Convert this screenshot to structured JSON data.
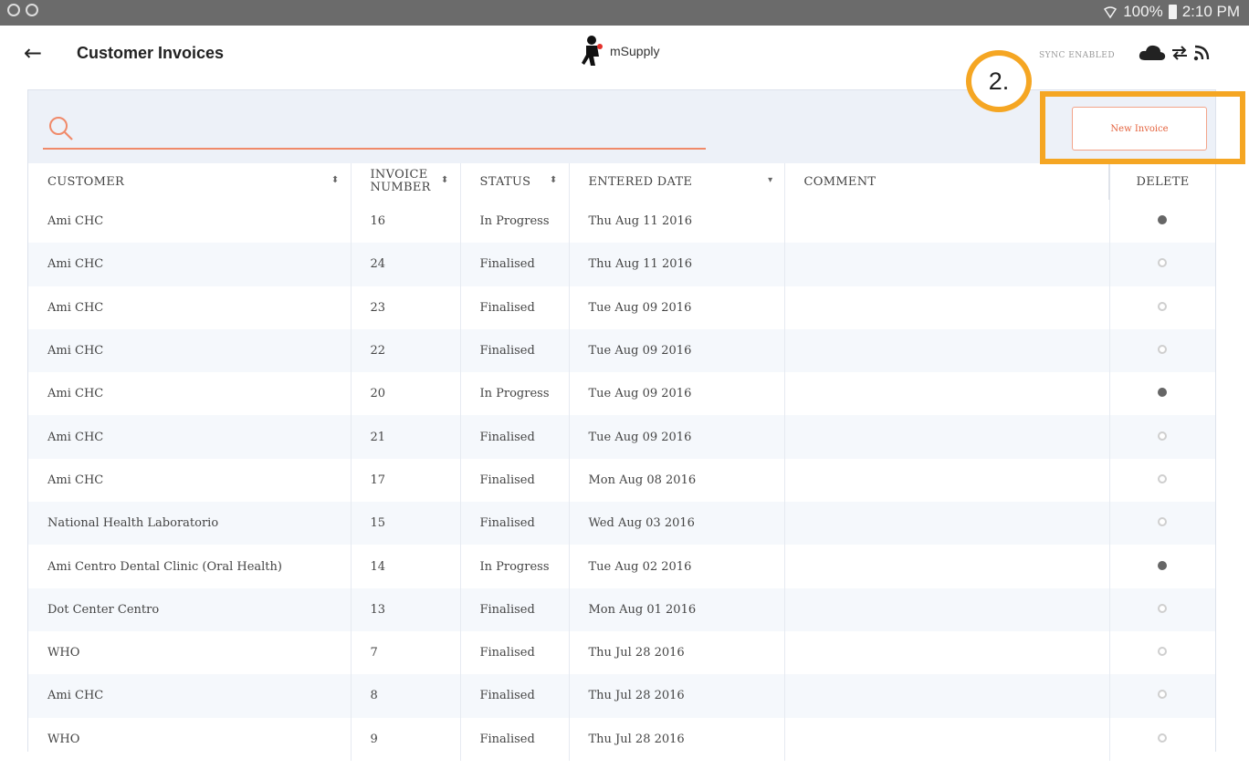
{
  "statusbar": {
    "battery": "100%",
    "time": "2:10 PM"
  },
  "header": {
    "title": "Customer Invoices",
    "logo_text": "mSupply",
    "sync_label": "SYNC ENABLED"
  },
  "search": {
    "placeholder": ""
  },
  "new_invoice": {
    "label": "New Invoice"
  },
  "columns": {
    "customer": "CUSTOMER",
    "invoice_number_l1": "INVOICE",
    "invoice_number_l2": "NUMBER",
    "status": "STATUS",
    "entered_date": "ENTERED DATE",
    "comment": "COMMENT",
    "delete": "DELETE"
  },
  "rows": [
    {
      "customer": "Ami CHC",
      "number": "16",
      "status": "In Progress",
      "date": "Thu Aug 11 2016",
      "comment": "",
      "deletable": true
    },
    {
      "customer": "Ami CHC",
      "number": "24",
      "status": "Finalised",
      "date": "Thu Aug 11 2016",
      "comment": "",
      "deletable": false
    },
    {
      "customer": "Ami CHC",
      "number": "23",
      "status": "Finalised",
      "date": "Tue Aug 09 2016",
      "comment": "",
      "deletable": false
    },
    {
      "customer": "Ami CHC",
      "number": "22",
      "status": "Finalised",
      "date": "Tue Aug 09 2016",
      "comment": "",
      "deletable": false
    },
    {
      "customer": "Ami CHC",
      "number": "20",
      "status": "In Progress",
      "date": "Tue Aug 09 2016",
      "comment": "",
      "deletable": true
    },
    {
      "customer": "Ami CHC",
      "number": "21",
      "status": "Finalised",
      "date": "Tue Aug 09 2016",
      "comment": "",
      "deletable": false
    },
    {
      "customer": "Ami CHC",
      "number": "17",
      "status": "Finalised",
      "date": "Mon Aug 08 2016",
      "comment": "",
      "deletable": false
    },
    {
      "customer": "National Health Laboratorio",
      "number": "15",
      "status": "Finalised",
      "date": "Wed Aug 03 2016",
      "comment": "",
      "deletable": false
    },
    {
      "customer": "Ami Centro Dental Clinic (Oral Health)",
      "number": "14",
      "status": "In Progress",
      "date": "Tue Aug 02 2016",
      "comment": "",
      "deletable": true
    },
    {
      "customer": "Dot Center Centro",
      "number": "13",
      "status": "Finalised",
      "date": "Mon Aug 01 2016",
      "comment": "",
      "deletable": false
    },
    {
      "customer": "WHO",
      "number": "7",
      "status": "Finalised",
      "date": "Thu Jul 28 2016",
      "comment": "",
      "deletable": false
    },
    {
      "customer": "Ami CHC",
      "number": "8",
      "status": "Finalised",
      "date": "Thu Jul 28 2016",
      "comment": "",
      "deletable": false
    },
    {
      "customer": "WHO",
      "number": "9",
      "status": "Finalised",
      "date": "Thu Jul 28 2016",
      "comment": "",
      "deletable": false
    }
  ],
  "annotation": {
    "step_label": "2.",
    "highlight_color": "#f5a623"
  },
  "colors": {
    "accent": "#e4633e",
    "search_underline": "#f08a6a",
    "panel_bg": "#edf1f8"
  },
  "icons": {
    "status_left": [
      "app-icon",
      "app-icon"
    ],
    "status_right": [
      "wifi-icon",
      "battery-icon"
    ],
    "sync": [
      "cloud-icon",
      "sync-arrows-icon",
      "signal-icon"
    ]
  }
}
